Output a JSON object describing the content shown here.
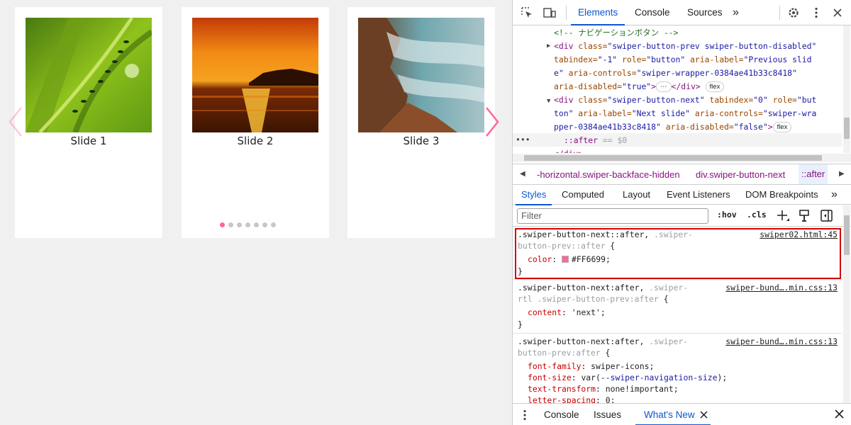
{
  "page": {
    "slides": [
      {
        "caption": "Slide 1",
        "image": "green grass with ants"
      },
      {
        "caption": "Slide 2",
        "image": "sunset over sea"
      },
      {
        "caption": "Slide 3",
        "image": "rocky coast with misty water"
      }
    ],
    "pagination": {
      "count": 7,
      "active": 1
    },
    "accent_color": "#FF6699"
  },
  "devtools": {
    "tabs": [
      "Elements",
      "Console",
      "Sources"
    ],
    "active_tab": "Elements",
    "more_tabs_glyph": "»",
    "dom": {
      "comment": "<!-- ナビゲーションボタン -->",
      "prev": {
        "line1_tag": "<div ",
        "line1_attr": "class=",
        "line1_val": "\"swiper-button-prev swiper-button-disabled\"",
        "line2_a1": "tabindex=",
        "line2_v1": "\"-1\"",
        "line2_a2": " role=",
        "line2_v2": "\"button\"",
        "line2_a3": " aria-label=",
        "line2_v3": "\"Previous slid",
        "line3_v": "e\"",
        "line3_a": " aria-controls=",
        "line3_v2": "\"swiper-wrapper-0384ae41b33c8418\"",
        "line4_a": "aria-disabled=",
        "line4_v": "\"true\"",
        "line4_tag": ">",
        "line4_close": "</div>",
        "ellipsis": "⋯",
        "pill": "flex"
      },
      "next": {
        "line1_tag": "<div ",
        "line1_a1": "class=",
        "line1_v1": "\"swiper-button-next\"",
        "line1_a2": " tabindex=",
        "line1_v2": "\"0\"",
        "line1_a3": " role=",
        "line1_v3": "\"but",
        "line2_v": "ton\"",
        "line2_a": " aria-label=",
        "line2_v2": "\"Next slide\"",
        "line2_a2": " aria-controls=",
        "line2_v3": "\"swiper-wra",
        "line3_v": "pper-0384ae41b33c8418\"",
        "line3_a": " aria-disabled=",
        "line3_v2": "\"false\"",
        "line3_tag": ">",
        "pill": "flex"
      },
      "selected_dots": "•••",
      "selected_pseudo": "::after",
      "selected_eq": " == $0",
      "cut_line": "</div>"
    },
    "breadcrumbs": [
      {
        "text": "-horizontal.swiper-backface-hidden",
        "color": "#881280"
      },
      {
        "text": "div.swiper-button-next",
        "color": "#881280"
      },
      {
        "text": "::after",
        "color": "#881280"
      }
    ],
    "subtabs": [
      "Styles",
      "Computed",
      "Layout",
      "Event Listeners",
      "DOM Breakpoints"
    ],
    "active_subtab": "Styles",
    "filter_placeholder": "Filter",
    "filter_buttons": [
      ":hov",
      ".cls"
    ],
    "rules": [
      {
        "selector_main": ".swiper-button-next::after,",
        "selector_dim1": " .swiper-",
        "selector_dim2": "button-prev::after",
        "open": " {",
        "source": "swiper02.html:45",
        "decls": [
          {
            "prop": "color",
            "value": "#FF6699",
            "swatch": true
          }
        ],
        "close": "}"
      },
      {
        "selector_main": ".swiper-button-next:after,",
        "selector_dim1": " .swiper-",
        "selector_dim2": "rtl .swiper-button-prev:after",
        "open": " {",
        "source": "swiper-bund….min.css:13",
        "decls": [
          {
            "prop": "content",
            "value": "'next'"
          }
        ],
        "close": "}"
      },
      {
        "selector_main": ".swiper-button-next:after,",
        "selector_dim1": " .swiper-",
        "selector_dim2": "button-prev:after",
        "open": " {",
        "source": "swiper-bund….min.css:13",
        "decls": [
          {
            "prop": "font-family",
            "value": "swiper-icons;"
          },
          {
            "prop": "font-size",
            "value_pre": "var(",
            "value_var": "--swiper-navigation-size",
            "value_post": ");"
          },
          {
            "prop": "text-transform",
            "value": "none!important;"
          },
          {
            "prop": "letter-spacing",
            "value": "0;"
          }
        ]
      }
    ],
    "drawer_tabs": [
      "Console",
      "Issues",
      "What's New"
    ],
    "active_drawer_tab": "What's New"
  }
}
